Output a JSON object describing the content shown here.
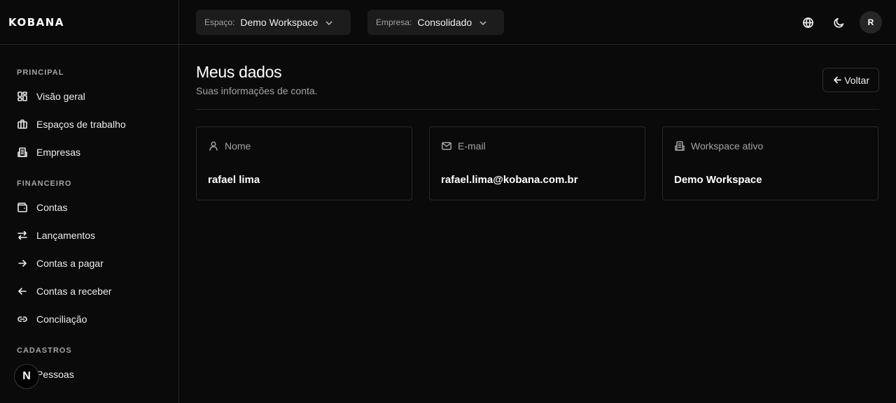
{
  "app": {
    "logo": "KOBANA"
  },
  "sidebar": {
    "sections": [
      {
        "title": "PRINCIPAL",
        "items": [
          {
            "label": "Visão geral",
            "icon": "dashboard-icon"
          },
          {
            "label": "Espaços de trabalho",
            "icon": "briefcase-icon"
          },
          {
            "label": "Empresas",
            "icon": "building-icon"
          }
        ]
      },
      {
        "title": "FINANCEIRO",
        "items": [
          {
            "label": "Contas",
            "icon": "wallet-icon"
          },
          {
            "label": "Lançamentos",
            "icon": "arrows-exchange-icon"
          },
          {
            "label": "Contas a pagar",
            "icon": "arrow-right-icon"
          },
          {
            "label": "Contas a receber",
            "icon": "arrow-left-icon"
          },
          {
            "label": "Conciliação",
            "icon": "link-icon"
          }
        ]
      },
      {
        "title": "CADASTROS",
        "items": [
          {
            "label": "Pessoas",
            "icon": "person-icon"
          }
        ]
      }
    ],
    "badge": "N"
  },
  "topbar": {
    "workspace": {
      "key": "Espaço:",
      "value": "Demo Workspace"
    },
    "company": {
      "key": "Empresa:",
      "value": "Consolidado"
    },
    "avatar": "R"
  },
  "page": {
    "title": "Meus dados",
    "subtitle": "Suas informações de conta.",
    "back_label": "Voltar",
    "cards": [
      {
        "label": "Nome",
        "value": "rafael lima",
        "icon": "user-icon"
      },
      {
        "label": "E-mail",
        "value": "rafael.lima@kobana.com.br",
        "icon": "mail-icon"
      },
      {
        "label": "Workspace ativo",
        "value": "Demo Workspace",
        "icon": "building-icon"
      }
    ]
  }
}
